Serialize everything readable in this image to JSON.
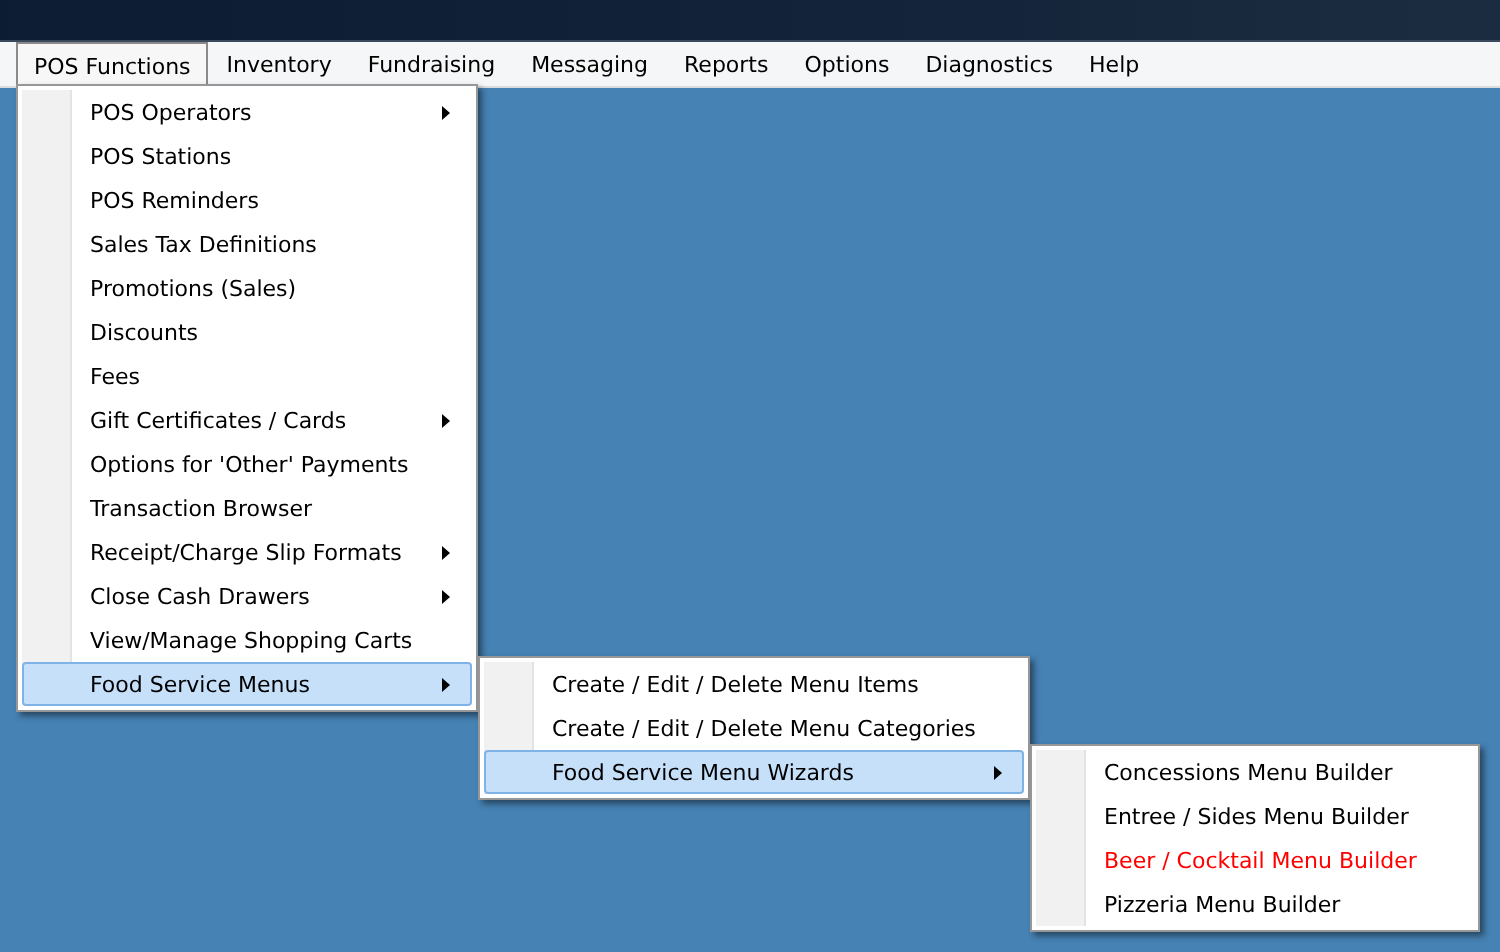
{
  "menubar": [
    {
      "label": "POS Functions",
      "selected": true,
      "children": [
        {
          "label": "POS Operators",
          "has_submenu": true,
          "selected": false
        },
        {
          "label": "POS Stations",
          "has_submenu": false,
          "selected": false
        },
        {
          "label": "POS Reminders",
          "has_submenu": false,
          "selected": false
        },
        {
          "label": "Sales Tax Definitions",
          "has_submenu": false,
          "selected": false
        },
        {
          "label": "Promotions (Sales)",
          "has_submenu": false,
          "selected": false
        },
        {
          "label": "Discounts",
          "has_submenu": false,
          "selected": false
        },
        {
          "label": "Fees",
          "has_submenu": false,
          "selected": false
        },
        {
          "label": "Gift Certificates / Cards",
          "has_submenu": true,
          "selected": false
        },
        {
          "label": "Options for 'Other' Payments",
          "has_submenu": false,
          "selected": false
        },
        {
          "label": "Transaction Browser",
          "has_submenu": false,
          "selected": false
        },
        {
          "label": "Receipt/Charge Slip Formats",
          "has_submenu": true,
          "selected": false
        },
        {
          "label": "Close Cash Drawers",
          "has_submenu": true,
          "selected": false
        },
        {
          "label": "View/Manage Shopping Carts",
          "has_submenu": false,
          "selected": false
        },
        {
          "label": "Food Service Menus",
          "has_submenu": true,
          "selected": true,
          "children": [
            {
              "label": "Create / Edit / Delete Menu Items",
              "has_submenu": false,
              "selected": false
            },
            {
              "label": "Create / Edit / Delete Menu Categories",
              "has_submenu": false,
              "selected": false
            },
            {
              "label": "Food Service Menu Wizards",
              "has_submenu": true,
              "selected": true,
              "children": [
                {
                  "label": "Concessions Menu Builder",
                  "has_submenu": false,
                  "selected": false,
                  "color": "#000000"
                },
                {
                  "label": "Entree / Sides Menu Builder",
                  "has_submenu": false,
                  "selected": false,
                  "color": "#000000"
                },
                {
                  "label": "Beer / Cocktail Menu Builder",
                  "has_submenu": false,
                  "selected": false,
                  "color": "#ff0000"
                },
                {
                  "label": "Pizzeria Menu Builder",
                  "has_submenu": false,
                  "selected": false,
                  "color": "#000000"
                }
              ]
            }
          ]
        }
      ]
    },
    {
      "label": "Inventory",
      "selected": false
    },
    {
      "label": "Fundraising",
      "selected": false
    },
    {
      "label": "Messaging",
      "selected": false
    },
    {
      "label": "Reports",
      "selected": false
    },
    {
      "label": "Options",
      "selected": false
    },
    {
      "label": "Diagnostics",
      "selected": false
    },
    {
      "label": "Help",
      "selected": false
    }
  ]
}
